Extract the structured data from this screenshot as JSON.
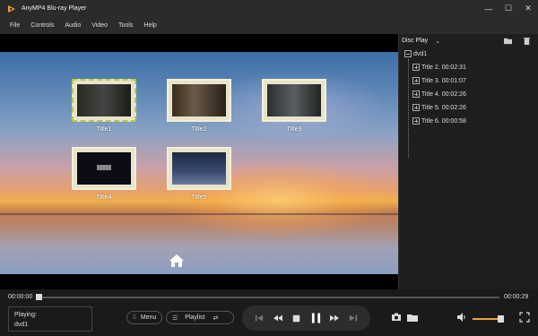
{
  "app": {
    "title": "AnyMP4 Blu-ray Player",
    "accent": "#f0a030"
  },
  "window_controls": [
    "minimize-icon",
    "maximize-icon",
    "close-icon"
  ],
  "menu": [
    "File",
    "Controls",
    "Audio",
    "Video",
    "Tools",
    "Help"
  ],
  "disc_menu": {
    "titles": [
      {
        "label": "Title1",
        "selected": true
      },
      {
        "label": "Title2",
        "selected": false
      },
      {
        "label": "Title3",
        "selected": false
      },
      {
        "label": "Title4",
        "selected": false
      },
      {
        "label": "Title5",
        "selected": false
      }
    ],
    "home_icon": "home-icon"
  },
  "side_panel": {
    "title": "Disc Play",
    "root": "dvd1",
    "items": [
      "Title 2. 00:02:31",
      "Title 3. 00:01:07",
      "Title 4. 00:02:26",
      "Title 5. 00:02:26",
      "Title 6. 00:00:58"
    ]
  },
  "progress": {
    "elapsed": "00:00:00",
    "total": "00:00:29",
    "fraction": 0.0
  },
  "bottom": {
    "playing_label": "Playing:",
    "playing_value": "dvd1",
    "menu_label": "Menu",
    "playlist_label": "Playlist",
    "volume_fraction": 0.8
  }
}
